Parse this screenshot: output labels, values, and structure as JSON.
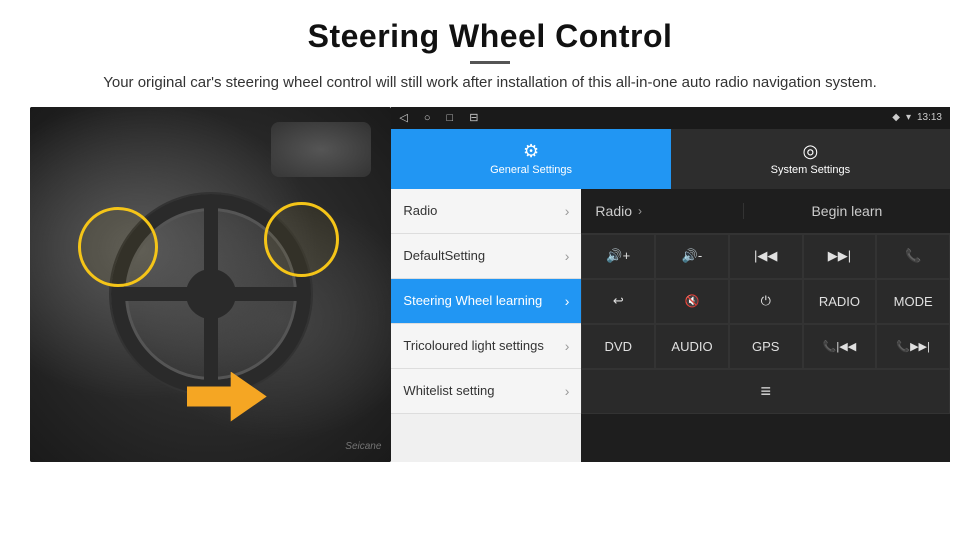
{
  "header": {
    "title": "Steering Wheel Control",
    "subtitle": "Your original car's steering wheel control will still work after installation of this all-in-one auto radio navigation system."
  },
  "status_bar": {
    "nav_icons": [
      "◁",
      "○",
      "□",
      "⊟"
    ],
    "time": "13:13",
    "signal_icons": [
      "◆",
      "▾"
    ]
  },
  "tabs": {
    "general": {
      "label": "General Settings",
      "icon": "⚙"
    },
    "system": {
      "label": "System Settings",
      "icon": "⊕"
    }
  },
  "menu_items": [
    {
      "label": "Radio",
      "active": false
    },
    {
      "label": "DefaultSetting",
      "active": false
    },
    {
      "label": "Steering Wheel learning",
      "active": true
    },
    {
      "label": "Tricoloured light settings",
      "active": false
    },
    {
      "label": "Whitelist setting",
      "active": false
    }
  ],
  "controls": {
    "begin_learn_label": "Begin learn",
    "row1": [
      "🔊+",
      "🔊-",
      "|◀◀",
      "▶▶|",
      "📞"
    ],
    "row2": [
      "↩",
      "🔊✕",
      "⏻",
      "RADIO",
      "MODE"
    ],
    "row3": [
      "DVD",
      "AUDIO",
      "GPS",
      "📞|◀◀",
      "📞▶▶|"
    ],
    "row4_icon": "≡"
  },
  "watermark": "Seicane"
}
